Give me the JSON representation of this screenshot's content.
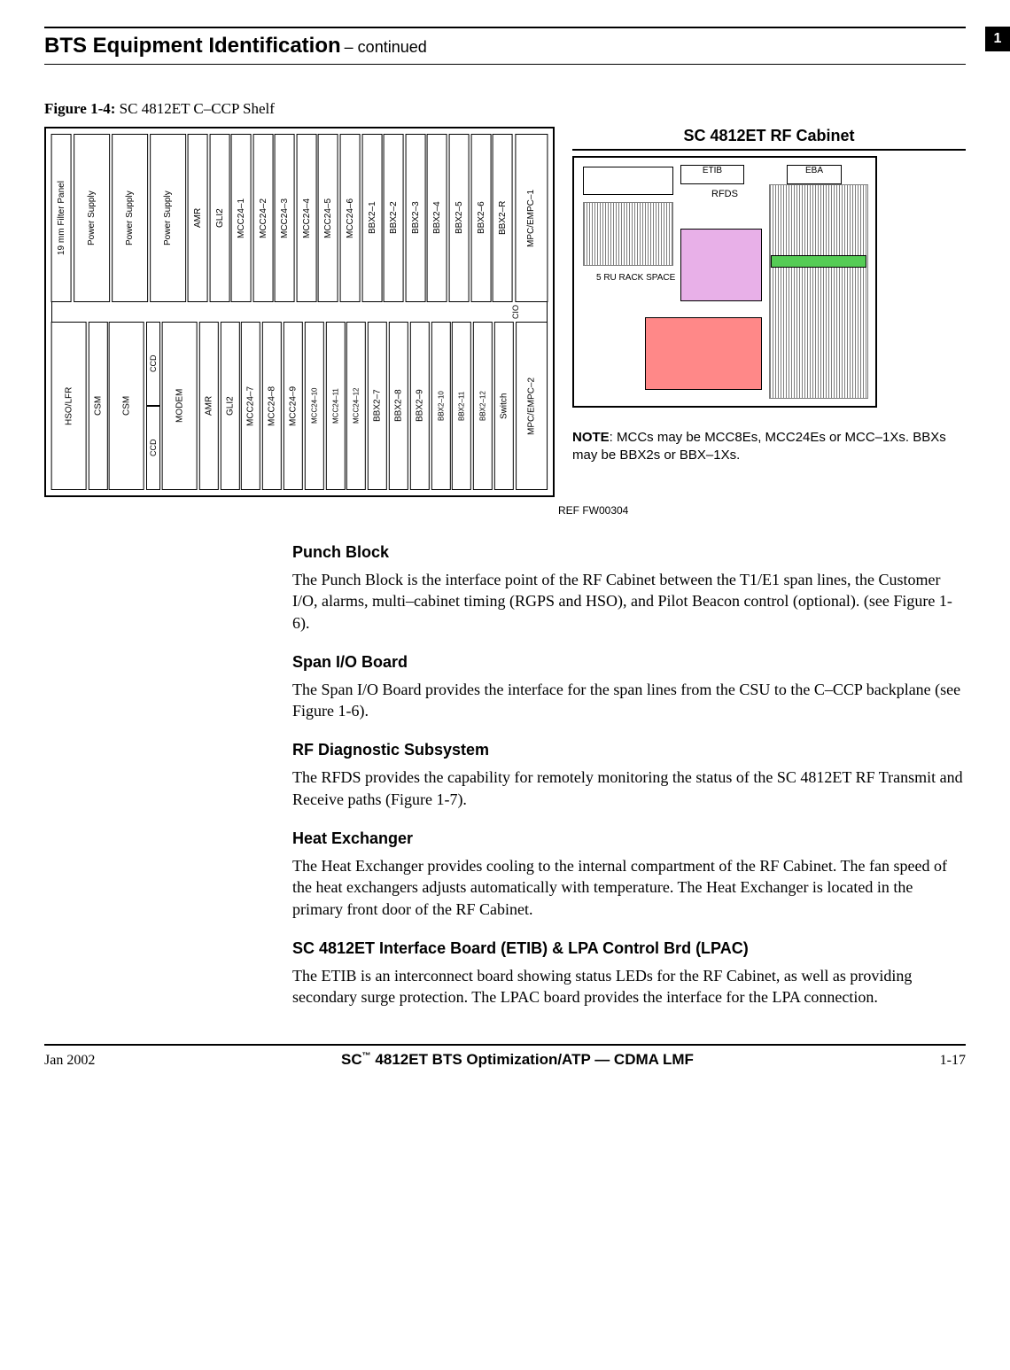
{
  "header": {
    "title": "BTS Equipment Identification",
    "continued": "– continued",
    "tab": "1"
  },
  "figure": {
    "label": "Figure 1-4:",
    "caption": "SC 4812ET C–CCP Shelf",
    "cabinet_title": "SC 4812ET RF Cabinet",
    "ref": "REF FW00304",
    "note_label": "NOTE",
    "note_text": ": MCCs may be MCC8Es, MCC24Es or MCC–1Xs. BBXs may be BBX2s or BBX–1Xs.",
    "cabinet_labels": {
      "etib": "ETIB",
      "eba": "EBA",
      "rfds": "RFDS",
      "rack": "5 RU RACK SPACE"
    },
    "top_slots": [
      "19 mm Filter Panel",
      "Power Supply",
      "Power Supply",
      "Power Supply",
      "AMR",
      "GLI2",
      "MCC24–1",
      "MCC24–2",
      "MCC24–3",
      "MCC24–4",
      "MCC24–5",
      "MCC24–6",
      "BBX2–1",
      "BBX2–2",
      "BBX2–3",
      "BBX2–4",
      "BBX2–5",
      "BBX2–6",
      "BBX2–R",
      "MPC/EMPC–1"
    ],
    "cio": "CIO",
    "bottom_slots_left": [
      "HSO/LFR",
      "CSM",
      "CSM"
    ],
    "ccd": "CCD",
    "modem": "MODEM",
    "bottom_slots_right": [
      "AMR",
      "GLI2",
      "MCC24–7",
      "MCC24–8",
      "MCC24–9",
      "MCC24–10",
      "MCC24–11",
      "MCC24–12",
      "BBX2–7",
      "BBX2–8",
      "BBX2–9",
      "BBX2–10",
      "BBX2–11",
      "BBX2–12",
      "Switch",
      "MPC/EMPC–2"
    ]
  },
  "sections": [
    {
      "heading": "Punch Block",
      "text": "The Punch Block is the interface point of the RF Cabinet between the T1/E1 span lines, the Customer I/O, alarms, multi–cabinet timing (RGPS and HSO), and Pilot Beacon control (optional). (see Figure 1-6)."
    },
    {
      "heading": "Span I/O Board",
      "text": "The Span I/O Board provides the interface for the span lines from the CSU to the C–CCP backplane (see Figure 1-6)."
    },
    {
      "heading": "RF Diagnostic Subsystem",
      "text": "The RFDS provides the capability for remotely monitoring the status of the SC 4812ET RF Transmit and Receive paths (Figure 1-7)."
    },
    {
      "heading": "Heat Exchanger",
      "text": "The Heat Exchanger provides cooling to the internal compartment of the RF Cabinet.  The fan speed of the heat exchangers adjusts automatically with temperature.  The Heat Exchanger is located in the primary front door of the RF Cabinet."
    },
    {
      "heading": "SC 4812ET Interface Board (ETIB) & LPA Control Brd (LPAC)",
      "text": "The ETIB is an interconnect board showing status LEDs for the RF Cabinet, as well as providing secondary surge protection. The LPAC board provides the interface for the LPA connection."
    }
  ],
  "footer": {
    "left": "Jan 2002",
    "center_prefix": "SC",
    "center_tm": "™",
    "center_rest": "4812ET BTS Optimization/ATP — CDMA LMF",
    "right": "1-17"
  }
}
